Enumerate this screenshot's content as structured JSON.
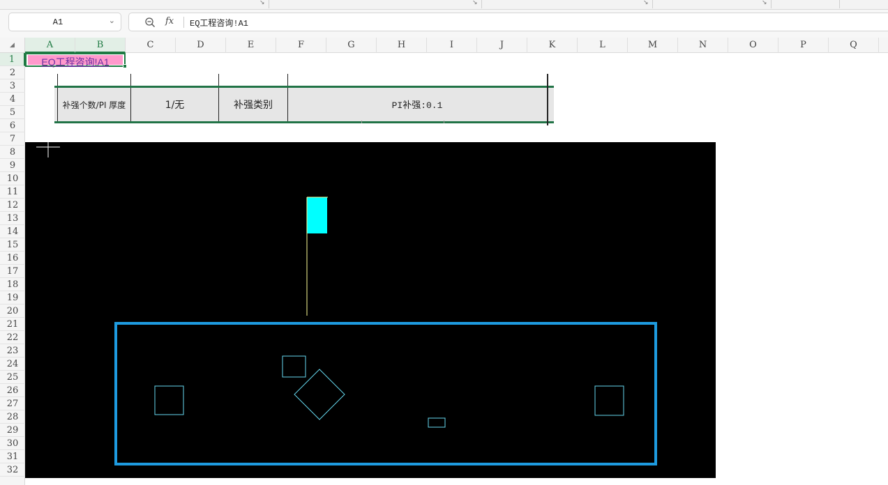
{
  "formula_bar": {
    "name_box": "A1",
    "fx_symbol": "fx",
    "content": "EQ工程咨询!A1"
  },
  "columns": [
    "A",
    "B",
    "C",
    "D",
    "E",
    "F",
    "G",
    "H",
    "I",
    "J",
    "K",
    "L",
    "M",
    "N",
    "O",
    "P",
    "Q"
  ],
  "rows": [
    "1",
    "2",
    "3",
    "4",
    "5",
    "6",
    "7",
    "8",
    "9",
    "10",
    "11",
    "12",
    "13",
    "14",
    "15",
    "16",
    "17",
    "18",
    "19",
    "20",
    "21",
    "22",
    "23",
    "24",
    "25",
    "26",
    "27",
    "28",
    "29",
    "30",
    "31",
    "32"
  ],
  "selected_cell": {
    "text": "EQ工程咨询!A1",
    "fill_color": "#ff99cc",
    "text_color": "#6b2fa0"
  },
  "spec_table": {
    "cell1": "补强个数/PI 厚度",
    "cell2": "1/无",
    "cell3": "补强类别",
    "cell4": "PI补强:0.1"
  },
  "cad_image": {
    "background": "#000000",
    "outline_color": "#ffff99",
    "frame_color": "#1e9be0",
    "pad_color": "#00ffff",
    "hole_color": "#66d9ef"
  },
  "colors": {
    "accent_green": "#217346",
    "header_bg": "#f5f5f5"
  }
}
